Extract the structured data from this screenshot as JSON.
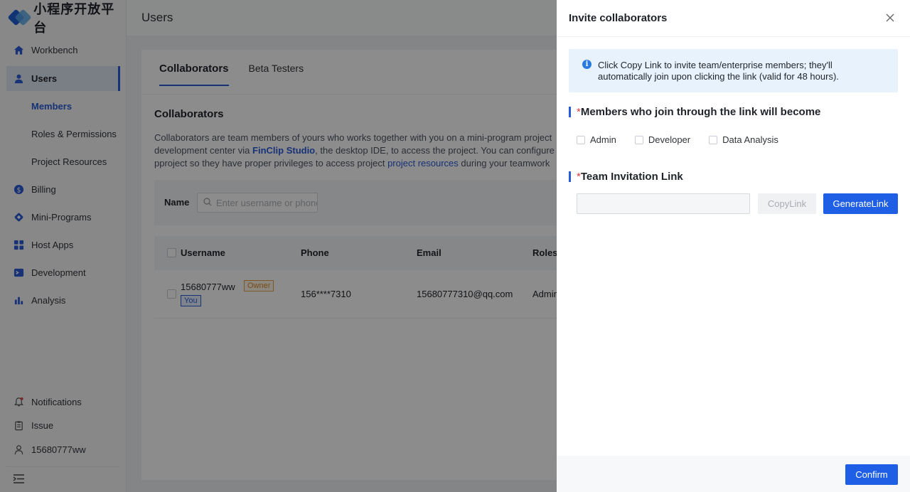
{
  "app": {
    "logo_text": "小程序开放平台"
  },
  "sidebar": {
    "items": [
      {
        "label": "Workbench",
        "icon": "home-icon"
      },
      {
        "label": "Users",
        "icon": "user-icon"
      },
      {
        "label": "Billing",
        "icon": "billing-icon"
      },
      {
        "label": "Mini-Programs",
        "icon": "mini-program-icon"
      },
      {
        "label": "Host Apps",
        "icon": "grid-icon"
      },
      {
        "label": "Development",
        "icon": "terminal-icon"
      },
      {
        "label": "Analysis",
        "icon": "bar-chart-icon"
      }
    ],
    "sub_items": [
      {
        "label": "Members"
      },
      {
        "label": "Roles & Permissions"
      },
      {
        "label": "Project Resources"
      }
    ],
    "bottom": [
      {
        "label": "Notifications",
        "icon": "bell-icon"
      },
      {
        "label": "Issue",
        "icon": "clipboard-icon"
      },
      {
        "label": "15680777ww",
        "icon": "account-icon"
      }
    ]
  },
  "header": {
    "title": "Users"
  },
  "main": {
    "tabs": [
      {
        "label": "Collaborators"
      },
      {
        "label": "Beta Testers"
      }
    ],
    "section_title": "Collaborators",
    "description": {
      "line1": "Collaborators are team members of yours who works together with you on a mini-program project",
      "line2_pre": "development center via ",
      "line2_link": "FinClip Studio",
      "line2_post": ", the desktop IDE, to access the project. You can configure",
      "line3_pre": "pproject so they have proper privileges to access project ",
      "line3_link": "project resources",
      "line3_post": " during your teamwork"
    },
    "filter": {
      "label": "Name",
      "placeholder": "Enter username or phone"
    },
    "table": {
      "headers": [
        "Username",
        "Phone",
        "Email",
        "Roles"
      ],
      "rows": [
        {
          "username": "15680777ww",
          "owner_tag": "Owner",
          "you_tag": "You",
          "phone": "156****7310",
          "email": "15680777310@qq.com",
          "role": "Admin"
        }
      ]
    }
  },
  "drawer": {
    "title": "Invite collaborators",
    "info_line1": "Click Copy Link to invite team/enterprise members; they'll",
    "info_line2": "automatically join upon clicking the link (valid for 48 hours).",
    "role_label": "Members who join through the link will become",
    "role_options": [
      "Admin",
      "Developer",
      "Data Analysis"
    ],
    "link_label": "Team Invitation Link",
    "link_value": "",
    "copy_label": "CopyLink",
    "generate_label": "GenerateLink",
    "confirm_label": "Confirm"
  },
  "colors": {
    "accent": "#1f5fe6",
    "required": "#e33b3b",
    "info_bg": "#e7f2fc"
  }
}
